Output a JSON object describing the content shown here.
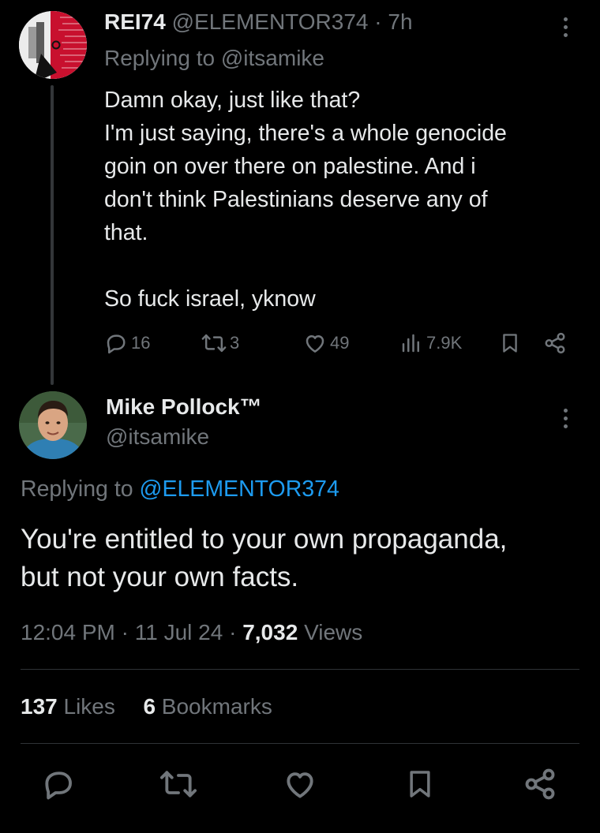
{
  "reply_tweet": {
    "display_name": "REI74",
    "handle": "@ELEMENTOR374",
    "separator": "·",
    "time": "7h",
    "replying_prefix": "Replying to ",
    "replying_to": "@itsamike",
    "text_lines": [
      "Damn okay, just like that?",
      "I'm just saying, there's a whole genocide",
      "goin on over there on palestine. And i",
      "don't think Palestinians deserve any of",
      "that.",
      "So fuck israel, yknow"
    ],
    "actions": {
      "replies": "16",
      "reposts": "3",
      "likes": "49",
      "views": "7.9K"
    }
  },
  "main_tweet": {
    "display_name": "Mike Pollock™",
    "handle": "@itsamike",
    "replying_prefix": "Replying to ",
    "replying_to": "@ELEMENTOR374",
    "text_lines": [
      "You're entitled to your own propaganda,",
      "but not your own facts."
    ],
    "time": "12:04 PM",
    "sep1": "·",
    "date": "11 Jul 24",
    "sep2": "·",
    "views_count": "7,032",
    "views_label": "Views",
    "likes_count": "137",
    "likes_label": "Likes",
    "bookmarks_count": "6",
    "bookmarks_label": "Bookmarks"
  },
  "colors": {
    "background": "#000000",
    "text": "#e7e9ea",
    "muted": "#71767b",
    "link": "#1d9bf0",
    "divider": "#2f3336"
  },
  "icons": [
    "more-icon",
    "reply-icon",
    "repost-icon",
    "like-icon",
    "views-icon",
    "bookmark-icon",
    "share-icon"
  ]
}
